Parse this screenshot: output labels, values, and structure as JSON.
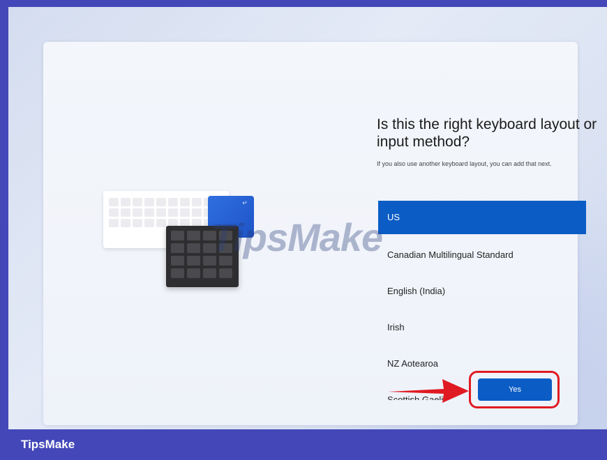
{
  "oobe": {
    "title": "Is this the right keyboard layout or input method?",
    "subtitle": "If you also use another keyboard layout, you can add that next.",
    "layouts": [
      {
        "label": "US",
        "selected": true
      },
      {
        "label": "Canadian Multilingual Standard",
        "selected": false
      },
      {
        "label": "English (India)",
        "selected": false
      },
      {
        "label": "Irish",
        "selected": false
      },
      {
        "label": "NZ Aotearoa",
        "selected": false
      },
      {
        "label": "Scottish Gaelic",
        "selected": false
      }
    ],
    "yes_label": "Yes"
  },
  "annotation": {
    "arrow_color": "#e01a22",
    "highlight_color": "#e01a22"
  },
  "watermark": "TipsMake",
  "footer": {
    "brand": "TipsMake"
  },
  "colors": {
    "accent": "#0b5cc5",
    "frame": "#4347b8"
  },
  "icons": {
    "illustration": "keyboard-illustration-icon",
    "enter_key": "enter-key-icon"
  }
}
